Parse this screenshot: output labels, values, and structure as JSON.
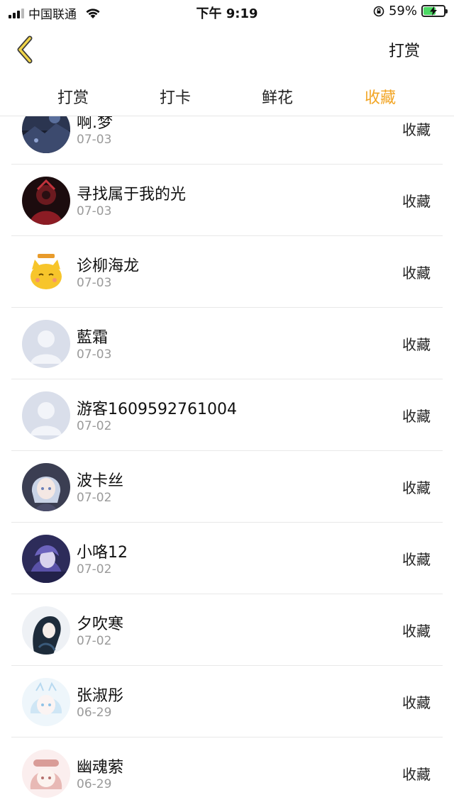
{
  "status_bar": {
    "carrier": "中国联通",
    "time": "下午 9:19",
    "battery": "59%",
    "battery_level": 0.59
  },
  "nav": {
    "back_icon": "chevron-left-icon",
    "action_label": "打赏"
  },
  "tabs": [
    {
      "label": "打赏",
      "active": false
    },
    {
      "label": "打卡",
      "active": false
    },
    {
      "label": "鲜花",
      "active": false
    },
    {
      "label": "收藏",
      "active": true
    }
  ],
  "colors": {
    "accent": "#f2a524",
    "divider": "#e8e8e8",
    "date_text": "#9a9a9a"
  },
  "entries": [
    {
      "name": "啊.梦",
      "date": "07-03",
      "action": "收藏",
      "avatar": "dark-night-scene"
    },
    {
      "name": "寻找属于我的光",
      "date": "07-03",
      "action": "收藏",
      "avatar": "dark-red-figure"
    },
    {
      "name": "诊柳海龙",
      "date": "07-03",
      "action": "收藏",
      "avatar": "yellow-cartoon-cat"
    },
    {
      "name": "藍霜",
      "date": "07-03",
      "action": "收藏",
      "avatar": "default-person"
    },
    {
      "name": "游客1609592761004",
      "date": "07-02",
      "action": "收藏",
      "avatar": "default-person"
    },
    {
      "name": "波卡丝",
      "date": "07-02",
      "action": "收藏",
      "avatar": "anime-silver-hair"
    },
    {
      "name": "小咯12",
      "date": "07-02",
      "action": "收藏",
      "avatar": "anime-purple"
    },
    {
      "name": "夕吹寒",
      "date": "07-02",
      "action": "收藏",
      "avatar": "anime-dark-hair"
    },
    {
      "name": "张淑彤",
      "date": "06-29",
      "action": "收藏",
      "avatar": "anime-pastel-blue"
    },
    {
      "name": "幽魂萦",
      "date": "06-29",
      "action": "收藏",
      "avatar": "anime-pastel-pink"
    }
  ]
}
